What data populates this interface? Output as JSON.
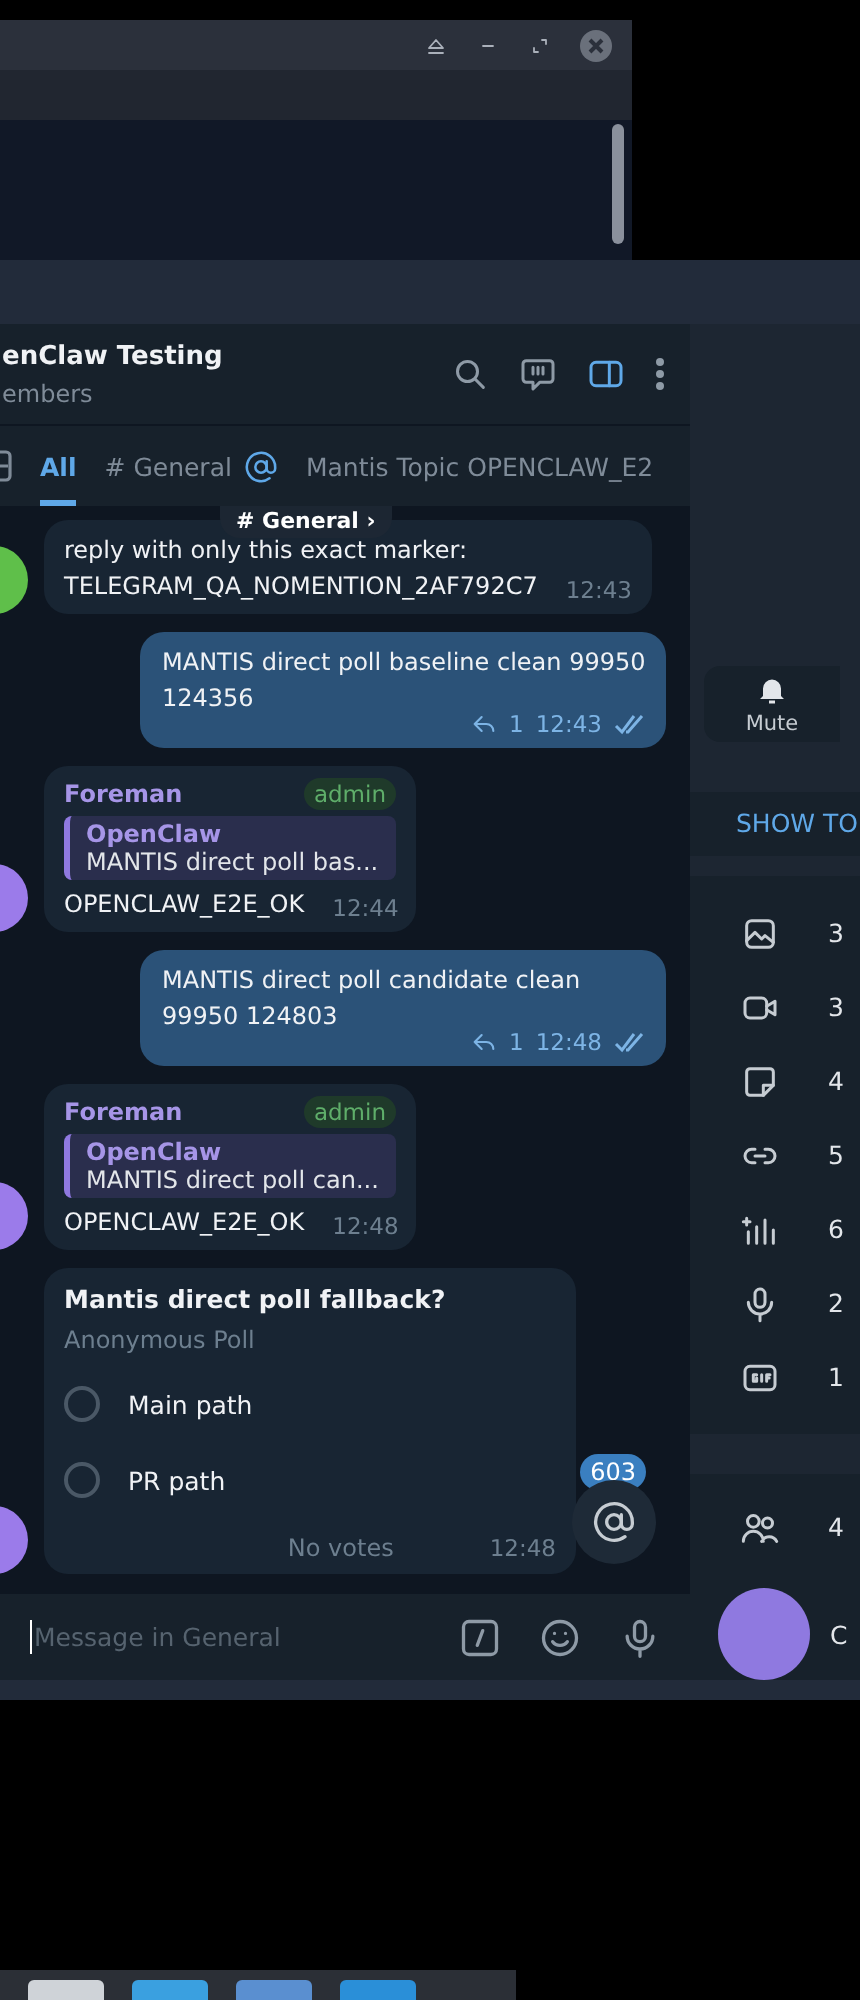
{
  "chat": {
    "title": "enClaw Testing",
    "subtitle": "embers",
    "tabs": [
      {
        "label": "All",
        "selected": true,
        "mention": false
      },
      {
        "label": "# General",
        "selected": false,
        "mention": true
      },
      {
        "label": "Mantis Topic OPENCLAW_E2",
        "selected": false,
        "mention": false
      }
    ],
    "topic_pill": "# General ›",
    "messages": [
      {
        "kind": "incoming",
        "color": "#5fbf4a",
        "lines": [
          "reply with only this exact marker:",
          "TELEGRAM_QA_NOMENTION_2AF792C7"
        ],
        "time": "12:43"
      },
      {
        "kind": "outgoing",
        "text": "MANTIS direct poll baseline clean 99950 124356",
        "replies": "1",
        "time": "12:43",
        "read": true
      },
      {
        "kind": "reply",
        "color": "#9b7bea",
        "sender": "Foreman",
        "badge": "admin",
        "quote_author": "OpenClaw",
        "quote_text": "MANTIS direct poll bas...",
        "text": "OPENCLAW_E2E_OK",
        "time": "12:44"
      },
      {
        "kind": "outgoing",
        "text": "MANTIS direct poll candidate clean 99950 124803",
        "replies": "1",
        "time": "12:48",
        "read": true
      },
      {
        "kind": "reply",
        "color": "#9b7bea",
        "sender": "Foreman",
        "badge": "admin",
        "quote_author": "OpenClaw",
        "quote_text": "MANTIS direct poll can...",
        "text": "OPENCLAW_E2E_OK",
        "time": "12:48"
      },
      {
        "kind": "poll",
        "color": "#9b7bea",
        "question": "Mantis direct poll fallback?",
        "poll_type": "Anonymous Poll",
        "options": [
          {
            "label": "Main path",
            "selected": false
          },
          {
            "label": "PR path",
            "selected": false
          }
        ],
        "footer": "No votes",
        "time": "12:48"
      }
    ],
    "unread_badge": "603",
    "composer": {
      "placeholder": "Message in General"
    }
  },
  "info_panel": {
    "mute_label": "Mute",
    "topics_button": "SHOW TO",
    "media": [
      {
        "kind": "photos",
        "count": "3"
      },
      {
        "kind": "videos",
        "count": "3"
      },
      {
        "kind": "files",
        "count": "4"
      },
      {
        "kind": "links",
        "count": "5"
      },
      {
        "kind": "audio",
        "count": "6"
      },
      {
        "kind": "voice",
        "count": "2"
      },
      {
        "kind": "gifs",
        "count": "1"
      }
    ],
    "members_count": "4",
    "member_initial": "C"
  }
}
